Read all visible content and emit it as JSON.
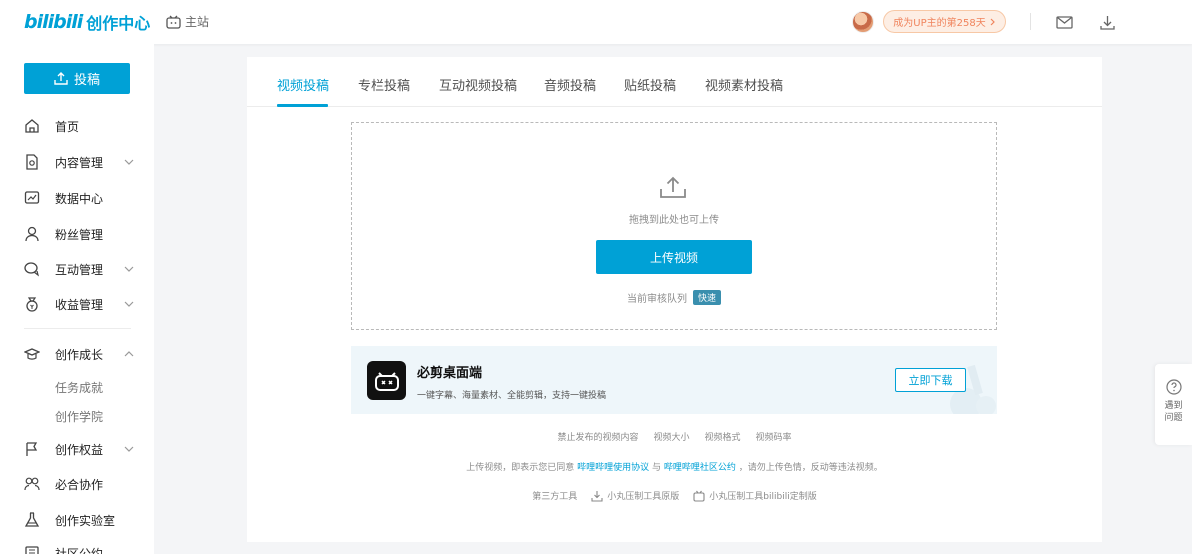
{
  "header": {
    "logo_text": "bilibili",
    "logo_suffix": "创作中心",
    "home_link": "主站",
    "up_badge": "成为UP主的第258天",
    "colors": {
      "brand": "#00a1d6",
      "badge_text": "#f0845d"
    }
  },
  "sidebar": {
    "submit_label": "投稿",
    "items": [
      {
        "label": "首页",
        "icon": "home-icon"
      },
      {
        "label": "内容管理",
        "icon": "document-icon",
        "expandable": true
      },
      {
        "label": "数据中心",
        "icon": "chart-icon"
      },
      {
        "label": "粉丝管理",
        "icon": "user-icon"
      },
      {
        "label": "互动管理",
        "icon": "chat-icon",
        "expandable": true
      },
      {
        "label": "收益管理",
        "icon": "moneybag-icon",
        "expandable": true
      },
      {
        "label": "创作成长",
        "icon": "graduation-cap-icon",
        "expanded": true
      },
      {
        "label": "创作权益",
        "icon": "flag-icon",
        "expandable": true
      },
      {
        "label": "必合协作",
        "icon": "people-icon"
      },
      {
        "label": "创作实验室",
        "icon": "flask-icon"
      },
      {
        "label": "社区公约",
        "icon": "book-icon"
      }
    ],
    "sub_items": [
      "任务成就",
      "创作学院"
    ]
  },
  "main": {
    "tabs": [
      "视频投稿",
      "专栏投稿",
      "互动视频投稿",
      "音频投稿",
      "贴纸投稿",
      "视频素材投稿"
    ],
    "active_tab": "视频投稿",
    "drop_hint": "拖拽到此处也可上传",
    "upload_button": "上传视频",
    "queue_label": "当前审核队列",
    "queue_status": "快速",
    "bijian": {
      "title": "必剪桌面端",
      "description": "一键字幕、海量素材、全能剪辑，支持一键投稿",
      "button": "立即下载"
    },
    "links": [
      "禁止发布的视频内容",
      "视频大小",
      "视频格式",
      "视频码率"
    ],
    "agreement": {
      "prefix": "上传视频，即表示您已同意",
      "link1": "哔哩哔哩使用协议",
      "middle": "与",
      "link2": "哔哩哔哩社区公约",
      "suffix": "，请勿上传色情，反动等违法视频。"
    },
    "tools": {
      "label": "第三方工具",
      "tool1": "小丸压制工具原版",
      "tool2": "小丸压制工具bilibili定制版"
    }
  },
  "help": {
    "label": "遇到问题"
  }
}
